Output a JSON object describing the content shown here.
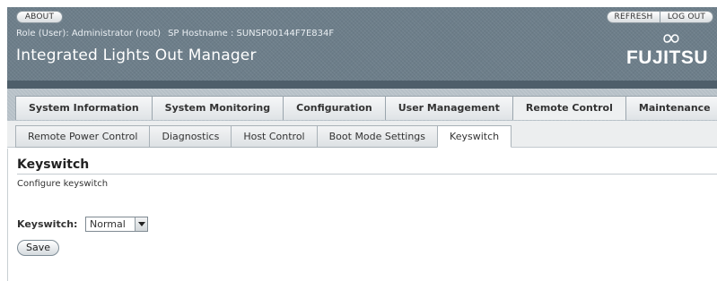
{
  "masthead": {
    "about_label": "ABOUT",
    "refresh_label": "REFRESH",
    "logout_label": "LOG OUT",
    "role_text": "Role (User): Administrator (root)",
    "hostname_text": "SP Hostname : SUNSP00144F7E834F",
    "app_title": "Integrated Lights Out Manager",
    "brand_text": "FUJITSU"
  },
  "primary_tabs": [
    {
      "label": "System Information"
    },
    {
      "label": "System Monitoring"
    },
    {
      "label": "Configuration"
    },
    {
      "label": "User Management"
    },
    {
      "label": "Remote Control",
      "selected": true
    },
    {
      "label": "Maintenance"
    }
  ],
  "secondary_tabs": [
    {
      "label": "Remote Power Control"
    },
    {
      "label": "Diagnostics"
    },
    {
      "label": "Host Control"
    },
    {
      "label": "Boot Mode Settings"
    },
    {
      "label": "Keyswitch",
      "selected": true
    }
  ],
  "content": {
    "title": "Keyswitch",
    "help_text": "Configure keyswitch",
    "keyswitch_label": "Keyswitch:",
    "keyswitch_value": "Normal",
    "save_label": "Save"
  },
  "colors": {
    "masthead_bg": "#6d7e8a",
    "tabbar_bg": "#b6c0c7"
  }
}
